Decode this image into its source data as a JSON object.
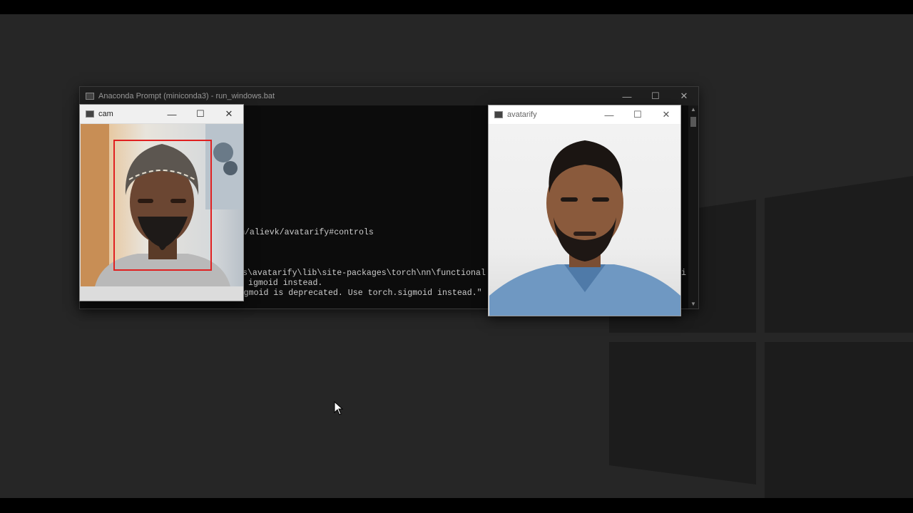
{
  "prompt_window": {
    "title": "Anaconda Prompt (miniconda3) - run_windows.bat",
    "console_lines": [
      "m/alievk/avatarify#controls",
      "s\\avatarify\\lib\\site-packages\\torch\\nn\\functional",
      "igmoid instead.",
      "warnings.warn(\"nn.functional.sigmoid is deprecated. Use torch.sigmoid instead.\""
    ],
    "console_tail_right": "si"
  },
  "cam_window": {
    "title": "cam"
  },
  "avatarify_window": {
    "title": "avatarify"
  },
  "controls": {
    "minimize": "—",
    "maximize": "☐",
    "close": "✕"
  },
  "colors": {
    "desktop": "#262626",
    "console_bg": "#0c0c0c",
    "console_text": "#cccccc",
    "face_box": "#e02020"
  },
  "icons": [
    "console-icon",
    "window-icon",
    "mouse-cursor-icon"
  ]
}
